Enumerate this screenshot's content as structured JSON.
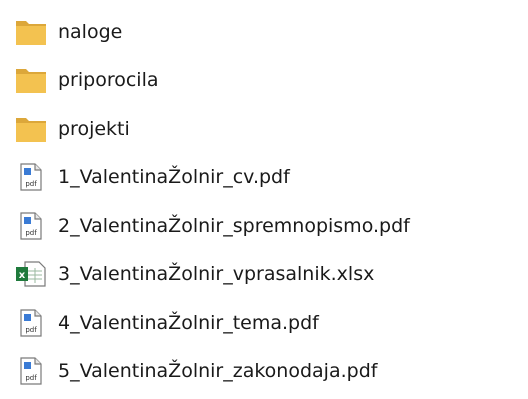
{
  "items": [
    {
      "name": "naloge",
      "type": "folder",
      "icon": "folder-icon"
    },
    {
      "name": "priporocila",
      "type": "folder",
      "icon": "folder-icon"
    },
    {
      "name": "projekti",
      "type": "folder",
      "icon": "folder-icon"
    },
    {
      "name": "1_ValentinaŽolnir_cv.pdf",
      "type": "pdf",
      "icon": "pdf-file-icon"
    },
    {
      "name": "2_ValentinaŽolnir_spremnopismo.pdf",
      "type": "pdf",
      "icon": "pdf-file-icon"
    },
    {
      "name": "3_ValentinaŽolnir_vprasalnik.xlsx",
      "type": "xlsx",
      "icon": "excel-file-icon"
    },
    {
      "name": "4_ValentinaŽolnir_tema.pdf",
      "type": "pdf",
      "icon": "pdf-file-icon"
    },
    {
      "name": "5_ValentinaŽolnir_zakonodaja.pdf",
      "type": "pdf",
      "icon": "pdf-file-icon"
    }
  ],
  "colors": {
    "folder": "#f3c250",
    "folder_dark": "#dca73a",
    "pdf_accent": "#3a7bd5",
    "excel": "#1f7a3c"
  }
}
